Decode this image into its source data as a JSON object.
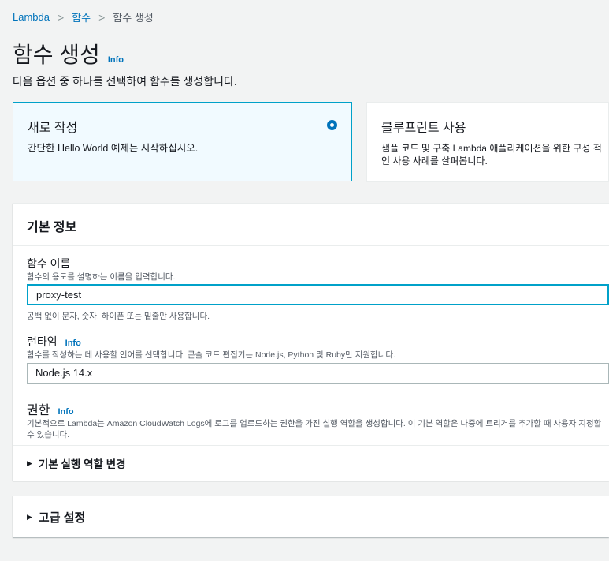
{
  "breadcrumb": [
    "Lambda",
    "함수",
    "함수 생성"
  ],
  "page": {
    "title": "함수 생성",
    "info": "Info",
    "description": "다음 옵션 중 하나를 선택하여 함수를 생성합니다."
  },
  "options": [
    {
      "title": "새로 작성",
      "description": "간단한 Hello World 예제는 시작하십시오.",
      "selected": true
    },
    {
      "title": "블루프린트 사용",
      "description": "샘플 코드 및 구축 Lambda 애플리케이션을 위한 구성 적인 사용 사례를 살펴봅니다.",
      "selected": false
    }
  ],
  "basic": {
    "header": "기본 정보",
    "name_label": "함수 이름",
    "name_desc": "함수의 용도를 설명하는 이름을 입력합니다.",
    "name_value": "proxy-test",
    "name_hint": "공백 없이 문자, 숫자, 하이픈 또는 밑줄만 사용합니다.",
    "runtime_label": "런타임",
    "runtime_info": "Info",
    "runtime_desc": "함수를 작성하는 데 사용할 언어를 선택합니다. 콘솔 코드 편집기는 Node.js, Python 및 Ruby만 지원합니다.",
    "runtime_value": "Node.js 14.x",
    "perm_label": "권한",
    "perm_info": "Info",
    "perm_desc": "기본적으로 Lambda는 Amazon CloudWatch Logs에 로그를 업로드하는 권한을 가진 실행 역할을 생성합니다. 이 기본 역할은 나중에 트리거를 추가할 때 사용자 지정할 수 있습니다.",
    "role_toggle": "기본 실행 역할 변경"
  },
  "advanced": {
    "label": "고급 설정"
  }
}
